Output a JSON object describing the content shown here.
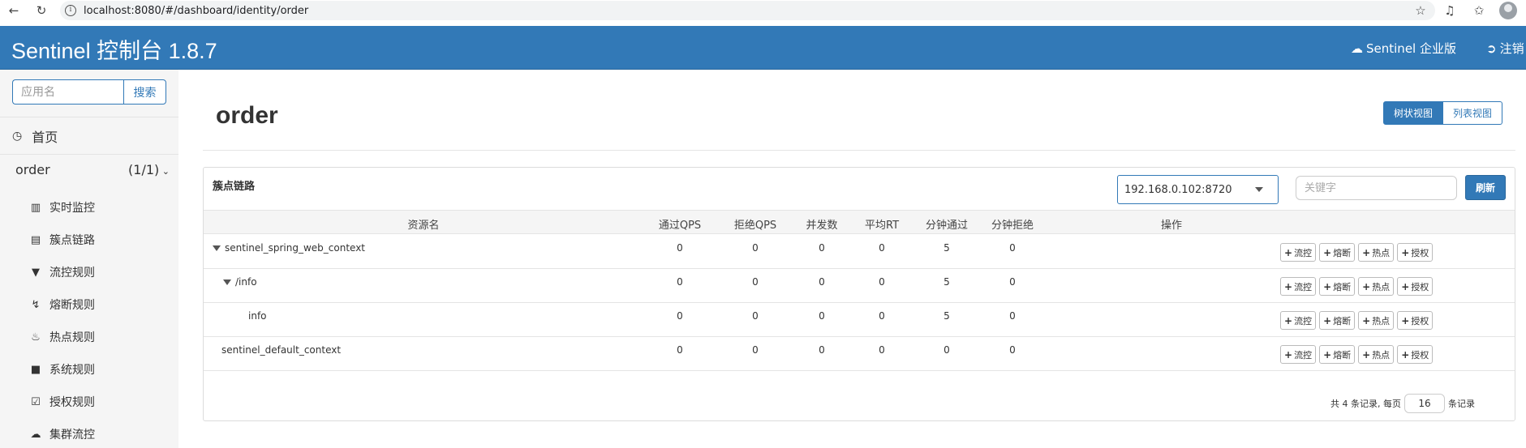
{
  "browser": {
    "url": "localhost:8080/#/dashboard/identity/order"
  },
  "header": {
    "brand": "Sentinel 控制台 1.8.7",
    "enterprise": "Sentinel 企业版",
    "logout": "注销"
  },
  "sidebar": {
    "search_placeholder": "应用名",
    "search_button": "搜索",
    "home": "首页",
    "app": {
      "name": "order",
      "count": "(1/1)"
    },
    "menu": [
      {
        "label": "实时监控",
        "icon": "bar-chart-icon"
      },
      {
        "label": "簇点链路",
        "icon": "list-icon"
      },
      {
        "label": "流控规则",
        "icon": "filter-icon"
      },
      {
        "label": "熔断规则",
        "icon": "flash-icon"
      },
      {
        "label": "热点规则",
        "icon": "fire-icon"
      },
      {
        "label": "系统规则",
        "icon": "lock-icon"
      },
      {
        "label": "授权规则",
        "icon": "check-icon"
      },
      {
        "label": "集群流控",
        "icon": "cloud-icon"
      }
    ]
  },
  "main": {
    "title": "order",
    "view_tree": "树状视图",
    "view_list": "列表视图",
    "panel_title": "簇点链路",
    "machine": "192.168.0.102:8720",
    "keyword_placeholder": "关键字",
    "refresh": "刷新",
    "columns": [
      "资源名",
      "通过QPS",
      "拒绝QPS",
      "并发数",
      "平均RT",
      "分钟通过",
      "分钟拒绝",
      "操作"
    ],
    "rows": [
      {
        "name": "sentinel_spring_web_context",
        "pass_qps": "0",
        "block_qps": "0",
        "concurrency": "0",
        "avg_rt": "0",
        "minute_pass": "5",
        "minute_block": "0"
      },
      {
        "name": "/info",
        "pass_qps": "0",
        "block_qps": "0",
        "concurrency": "0",
        "avg_rt": "0",
        "minute_pass": "5",
        "minute_block": "0"
      },
      {
        "name": "info",
        "pass_qps": "0",
        "block_qps": "0",
        "concurrency": "0",
        "avg_rt": "0",
        "minute_pass": "5",
        "minute_block": "0"
      },
      {
        "name": "sentinel_default_context",
        "pass_qps": "0",
        "block_qps": "0",
        "concurrency": "0",
        "avg_rt": "0",
        "minute_pass": "0",
        "minute_block": "0"
      }
    ],
    "actions": [
      "流控",
      "熔断",
      "热点",
      "授权"
    ],
    "pager": {
      "prefix": "共 4 条记录, 每页",
      "page_size": "16",
      "suffix": "条记录"
    }
  }
}
